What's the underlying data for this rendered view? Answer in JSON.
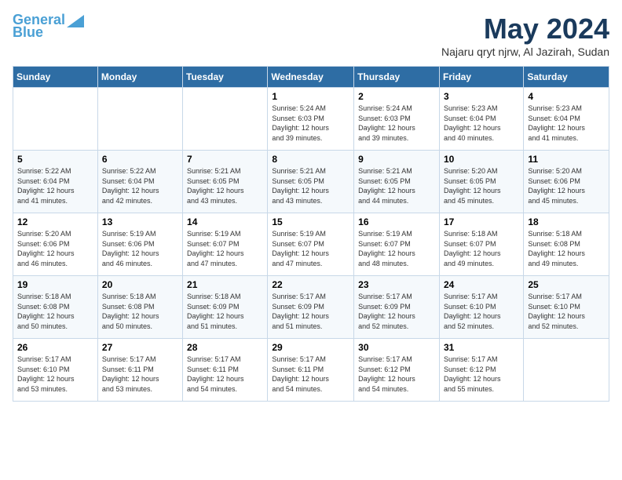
{
  "logo": {
    "line1": "General",
    "line2": "Blue"
  },
  "title": "May 2024",
  "location": "Najaru qryt njrw, Al Jazirah, Sudan",
  "days_of_week": [
    "Sunday",
    "Monday",
    "Tuesday",
    "Wednesday",
    "Thursday",
    "Friday",
    "Saturday"
  ],
  "weeks": [
    [
      {
        "day": "",
        "info": ""
      },
      {
        "day": "",
        "info": ""
      },
      {
        "day": "",
        "info": ""
      },
      {
        "day": "1",
        "info": "Sunrise: 5:24 AM\nSunset: 6:03 PM\nDaylight: 12 hours\nand 39 minutes."
      },
      {
        "day": "2",
        "info": "Sunrise: 5:24 AM\nSunset: 6:03 PM\nDaylight: 12 hours\nand 39 minutes."
      },
      {
        "day": "3",
        "info": "Sunrise: 5:23 AM\nSunset: 6:04 PM\nDaylight: 12 hours\nand 40 minutes."
      },
      {
        "day": "4",
        "info": "Sunrise: 5:23 AM\nSunset: 6:04 PM\nDaylight: 12 hours\nand 41 minutes."
      }
    ],
    [
      {
        "day": "5",
        "info": "Sunrise: 5:22 AM\nSunset: 6:04 PM\nDaylight: 12 hours\nand 41 minutes."
      },
      {
        "day": "6",
        "info": "Sunrise: 5:22 AM\nSunset: 6:04 PM\nDaylight: 12 hours\nand 42 minutes."
      },
      {
        "day": "7",
        "info": "Sunrise: 5:21 AM\nSunset: 6:05 PM\nDaylight: 12 hours\nand 43 minutes."
      },
      {
        "day": "8",
        "info": "Sunrise: 5:21 AM\nSunset: 6:05 PM\nDaylight: 12 hours\nand 43 minutes."
      },
      {
        "day": "9",
        "info": "Sunrise: 5:21 AM\nSunset: 6:05 PM\nDaylight: 12 hours\nand 44 minutes."
      },
      {
        "day": "10",
        "info": "Sunrise: 5:20 AM\nSunset: 6:05 PM\nDaylight: 12 hours\nand 45 minutes."
      },
      {
        "day": "11",
        "info": "Sunrise: 5:20 AM\nSunset: 6:06 PM\nDaylight: 12 hours\nand 45 minutes."
      }
    ],
    [
      {
        "day": "12",
        "info": "Sunrise: 5:20 AM\nSunset: 6:06 PM\nDaylight: 12 hours\nand 46 minutes."
      },
      {
        "day": "13",
        "info": "Sunrise: 5:19 AM\nSunset: 6:06 PM\nDaylight: 12 hours\nand 46 minutes."
      },
      {
        "day": "14",
        "info": "Sunrise: 5:19 AM\nSunset: 6:07 PM\nDaylight: 12 hours\nand 47 minutes."
      },
      {
        "day": "15",
        "info": "Sunrise: 5:19 AM\nSunset: 6:07 PM\nDaylight: 12 hours\nand 47 minutes."
      },
      {
        "day": "16",
        "info": "Sunrise: 5:19 AM\nSunset: 6:07 PM\nDaylight: 12 hours\nand 48 minutes."
      },
      {
        "day": "17",
        "info": "Sunrise: 5:18 AM\nSunset: 6:07 PM\nDaylight: 12 hours\nand 49 minutes."
      },
      {
        "day": "18",
        "info": "Sunrise: 5:18 AM\nSunset: 6:08 PM\nDaylight: 12 hours\nand 49 minutes."
      }
    ],
    [
      {
        "day": "19",
        "info": "Sunrise: 5:18 AM\nSunset: 6:08 PM\nDaylight: 12 hours\nand 50 minutes."
      },
      {
        "day": "20",
        "info": "Sunrise: 5:18 AM\nSunset: 6:08 PM\nDaylight: 12 hours\nand 50 minutes."
      },
      {
        "day": "21",
        "info": "Sunrise: 5:18 AM\nSunset: 6:09 PM\nDaylight: 12 hours\nand 51 minutes."
      },
      {
        "day": "22",
        "info": "Sunrise: 5:17 AM\nSunset: 6:09 PM\nDaylight: 12 hours\nand 51 minutes."
      },
      {
        "day": "23",
        "info": "Sunrise: 5:17 AM\nSunset: 6:09 PM\nDaylight: 12 hours\nand 52 minutes."
      },
      {
        "day": "24",
        "info": "Sunrise: 5:17 AM\nSunset: 6:10 PM\nDaylight: 12 hours\nand 52 minutes."
      },
      {
        "day": "25",
        "info": "Sunrise: 5:17 AM\nSunset: 6:10 PM\nDaylight: 12 hours\nand 52 minutes."
      }
    ],
    [
      {
        "day": "26",
        "info": "Sunrise: 5:17 AM\nSunset: 6:10 PM\nDaylight: 12 hours\nand 53 minutes."
      },
      {
        "day": "27",
        "info": "Sunrise: 5:17 AM\nSunset: 6:11 PM\nDaylight: 12 hours\nand 53 minutes."
      },
      {
        "day": "28",
        "info": "Sunrise: 5:17 AM\nSunset: 6:11 PM\nDaylight: 12 hours\nand 54 minutes."
      },
      {
        "day": "29",
        "info": "Sunrise: 5:17 AM\nSunset: 6:11 PM\nDaylight: 12 hours\nand 54 minutes."
      },
      {
        "day": "30",
        "info": "Sunrise: 5:17 AM\nSunset: 6:12 PM\nDaylight: 12 hours\nand 54 minutes."
      },
      {
        "day": "31",
        "info": "Sunrise: 5:17 AM\nSunset: 6:12 PM\nDaylight: 12 hours\nand 55 minutes."
      },
      {
        "day": "",
        "info": ""
      }
    ]
  ]
}
